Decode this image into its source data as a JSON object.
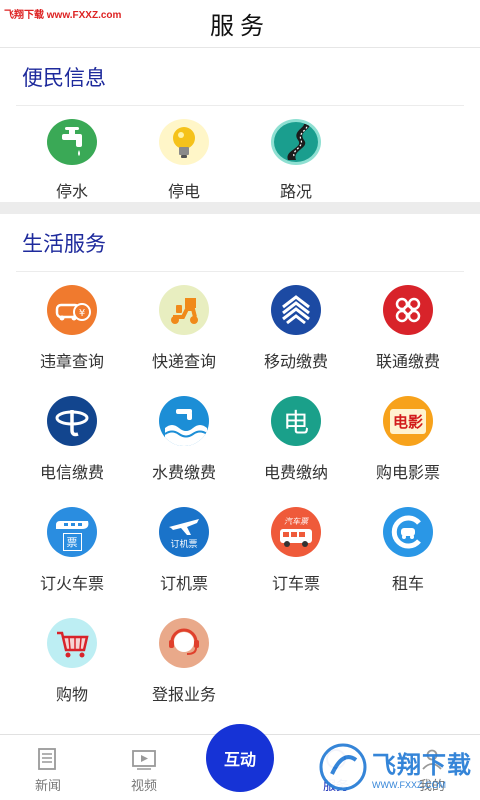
{
  "watermark": {
    "text": "飞翔下载 www.FXXZ.com"
  },
  "header": {
    "title": "服务"
  },
  "sections": [
    {
      "title": "便民信息",
      "items": [
        {
          "label": "停水",
          "icon": "water-tap-icon"
        },
        {
          "label": "停电",
          "icon": "lightbulb-icon"
        },
        {
          "label": "路况",
          "icon": "road-icon"
        }
      ]
    },
    {
      "title": "生活服务",
      "items": [
        {
          "label": "违章查询",
          "icon": "car-ticket-icon"
        },
        {
          "label": "快递查询",
          "icon": "delivery-scooter-icon"
        },
        {
          "label": "移动缴费",
          "icon": "china-mobile-icon"
        },
        {
          "label": "联通缴费",
          "icon": "china-unicom-icon"
        },
        {
          "label": "电信缴费",
          "icon": "china-telecom-icon"
        },
        {
          "label": "水费缴费",
          "icon": "water-wave-icon"
        },
        {
          "label": "电费缴纳",
          "icon": "electricity-icon",
          "glyph": "电"
        },
        {
          "label": "购电影票",
          "icon": "movie-ticket-icon",
          "glyph": "电影"
        },
        {
          "label": "订火车票",
          "icon": "train-icon",
          "glyph": "票"
        },
        {
          "label": "订机票",
          "icon": "airplane-icon",
          "glyph": "订机票"
        },
        {
          "label": "订车票",
          "icon": "bus-icon",
          "glyph": "汽车票"
        },
        {
          "label": "租车",
          "icon": "car-rental-icon"
        },
        {
          "label": "购物",
          "icon": "shopping-cart-icon"
        },
        {
          "label": "登报业务",
          "icon": "headset-agent-icon"
        }
      ]
    }
  ],
  "tabbar": {
    "tabs": [
      {
        "label": "新闻",
        "icon": "news-icon"
      },
      {
        "label": "视频",
        "icon": "video-icon"
      },
      {
        "label": "服务",
        "icon": "service-icon"
      },
      {
        "label": "我的",
        "icon": "profile-icon"
      }
    ],
    "center_label": "互动"
  },
  "watermark_logo": {
    "text": "飞翔下载",
    "url": "WWW.FXXZ.COM"
  },
  "colors": {
    "accent": "#1633d6",
    "section_title": "#1e2a9c"
  }
}
